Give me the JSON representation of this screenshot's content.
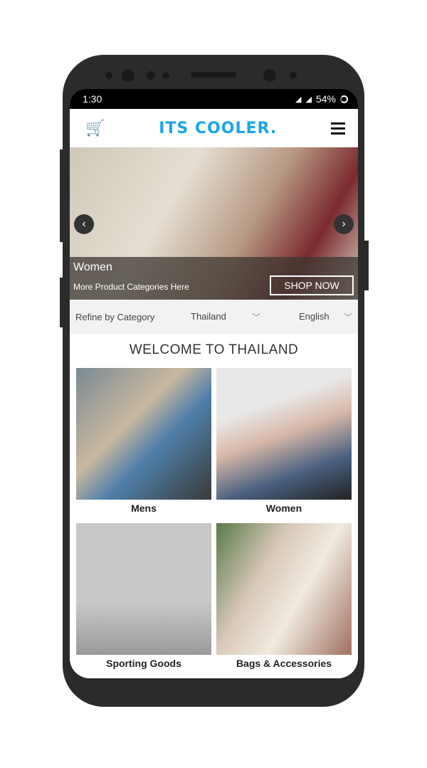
{
  "status": {
    "time": "1:30",
    "battery": "54%",
    "network": "4G"
  },
  "header": {
    "logo": "its cooler."
  },
  "hero": {
    "title": "Women",
    "subtitle": "More Product Categories Here",
    "cta": "SHOP NOW"
  },
  "filters": {
    "refine": "Refine by Category",
    "country": "Thailand",
    "language": "English"
  },
  "welcome": "WELCOME TO THAILAND",
  "categories": [
    {
      "label": "Mens"
    },
    {
      "label": "Women"
    },
    {
      "label": "Sporting Goods"
    },
    {
      "label": "Bags & Accessories"
    }
  ]
}
